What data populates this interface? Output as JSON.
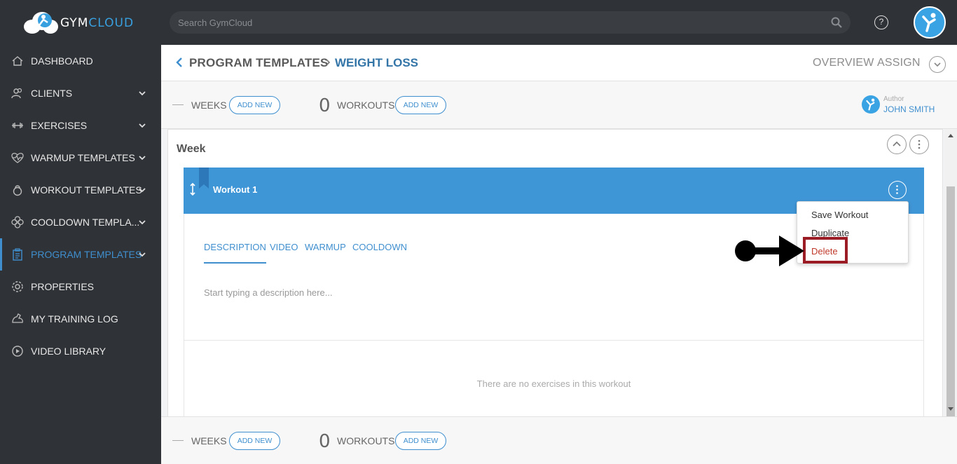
{
  "brand": {
    "part1": "GYM",
    "part2": "CLOUD",
    "accent": "#39a0e0"
  },
  "search": {
    "placeholder": "Search GymCloud"
  },
  "help": {
    "glyph": "?"
  },
  "sidebar": {
    "items": [
      {
        "label": "DASHBOARD",
        "icon": "home-icon",
        "has_chevron": false
      },
      {
        "label": "CLIENTS",
        "icon": "users-icon",
        "has_chevron": true
      },
      {
        "label": "EXERCISES",
        "icon": "dumbbell-icon",
        "has_chevron": true
      },
      {
        "label": "WARMUP TEMPLATES",
        "icon": "heartbeat-icon",
        "has_chevron": true
      },
      {
        "label": "WORKOUT TEMPLATES",
        "icon": "kettlebell-icon",
        "has_chevron": true
      },
      {
        "label": "COOLDOWN TEMPLA...",
        "icon": "flower-icon",
        "has_chevron": true
      },
      {
        "label": "PROGRAM TEMPLATES",
        "icon": "clipboard-icon",
        "has_chevron": true,
        "active": true
      },
      {
        "label": "PROPERTIES",
        "icon": "gear-icon",
        "has_chevron": false
      },
      {
        "label": "MY TRAINING LOG",
        "icon": "arm-icon",
        "has_chevron": false
      },
      {
        "label": "VIDEO LIBRARY",
        "icon": "play-icon",
        "has_chevron": false
      }
    ]
  },
  "header": {
    "crumb_parent": "PROGRAM TEMPLATES",
    "crumb_current": "WEIGHT LOSS",
    "links": [
      "OVERVIEW",
      "ASSIGN"
    ]
  },
  "toolbar": {
    "weeks_label": "WEEKS",
    "add_new": "ADD NEW",
    "workouts_count": "0",
    "workouts_label": "WORKOUTS",
    "author_label": "Author",
    "author_name": "JOHN SMITH"
  },
  "week": {
    "title": "Week",
    "workout": {
      "title": "Workout 1",
      "tabs": [
        "DESCRIPTION",
        "VIDEO",
        "WARMUP",
        "COOLDOWN"
      ],
      "description_placeholder": "Start typing a description here...",
      "empty_message": "There are no exercises in this workout"
    }
  },
  "menu": {
    "items": [
      "Save Workout",
      "Duplicate",
      "Delete"
    ]
  },
  "colors": {
    "sidebar_bg": "#2f3236",
    "accent_blue": "#3f8fcf",
    "workout_bar": "#3f96d6",
    "highlight": "#9b1c24",
    "danger": "#c0392b"
  }
}
